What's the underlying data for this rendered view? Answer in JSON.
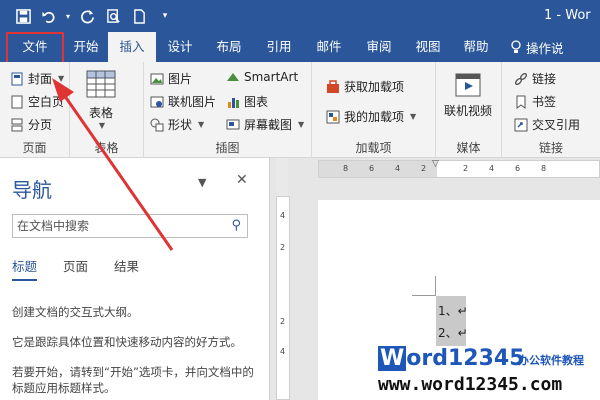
{
  "window": {
    "title": "1  -  Wor"
  },
  "tabs": [
    {
      "label": "文件"
    },
    {
      "label": "开始"
    },
    {
      "label": "插入"
    },
    {
      "label": "设计"
    },
    {
      "label": "布局"
    },
    {
      "label": "引用"
    },
    {
      "label": "邮件"
    },
    {
      "label": "审阅"
    },
    {
      "label": "视图"
    },
    {
      "label": "帮助"
    }
  ],
  "tell_me": "操作说",
  "ribbon": {
    "pages": {
      "label": "页面",
      "cover": "封面",
      "blank": "空白页",
      "break": "分页"
    },
    "table": {
      "label": "表格",
      "button": "表格"
    },
    "illustrations": {
      "label": "插图",
      "picture": "图片",
      "online_picture": "联机图片",
      "shapes": "形状",
      "smartart": "SmartArt",
      "chart": "图表",
      "screenshot": "屏幕截图"
    },
    "addins": {
      "label": "加载项",
      "get": "获取加载项",
      "my": "我的加载项"
    },
    "media": {
      "label": "媒体",
      "online_video": "联机视频"
    },
    "links": {
      "label": "链接",
      "link": "链接",
      "bookmark": "书签",
      "cross_ref": "交叉引用"
    }
  },
  "nav": {
    "title": "导航",
    "search_placeholder": "在文档中搜索",
    "tabs": [
      "标题",
      "页面",
      "结果"
    ],
    "p1": "创建文档的交互式大纲。",
    "p2": "它是跟踪具体位置和快速移动内容的好方式。",
    "p3": "若要开始，请转到“开始”选项卡，并向文档中的标题应用标题样式。"
  },
  "ruler": {
    "h": [
      "8",
      "6",
      "4",
      "2",
      "2",
      "4",
      "6",
      "8"
    ],
    "v": [
      "4",
      "2",
      "2",
      "4"
    ]
  },
  "doc": {
    "line1": "1、↵",
    "line2": "2、↵"
  },
  "watermark": {
    "brand_a": "W",
    "brand_b": "ord",
    "brand_c": "12345",
    "tag": "办公软件教程",
    "url": "www.word12345.com"
  },
  "colors": {
    "accent": "#2b579a",
    "highlight": "#e03434"
  }
}
